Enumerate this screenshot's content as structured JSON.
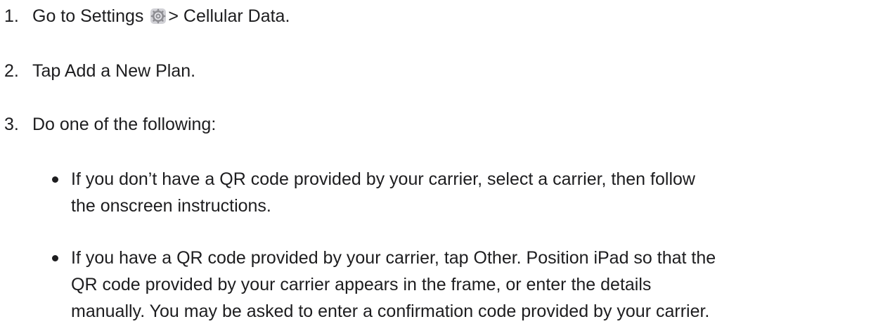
{
  "steps": [
    {
      "number": "1.",
      "text_before_icon": "Go to Settings",
      "icon": "settings-gear-icon",
      "text_after_icon": "> Cellular Data."
    },
    {
      "number": "2.",
      "text": "Tap Add a New Plan."
    },
    {
      "number": "3.",
      "text": "Do one of the following:"
    }
  ],
  "bullets": [
    {
      "text": "If you don’t have a QR code provided by your carrier, select a carrier, then follow\nthe onscreen instructions."
    },
    {
      "text": "If you have a QR code provided by your carrier, tap Other. Position iPad so that the\nQR code provided by your carrier appears in the frame, or enter the details\nmanually. You may be asked to enter a confirmation code provided by your carrier."
    }
  ],
  "colors": {
    "text": "#1d1d1f",
    "icon_gear": "#8e8e93",
    "icon_bg": "#d1d1d6"
  }
}
